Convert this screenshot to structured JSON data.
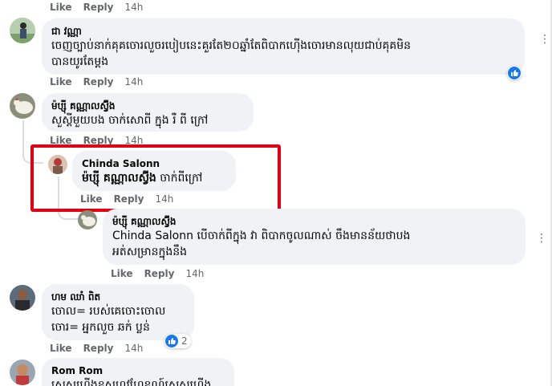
{
  "colors": {
    "accent": "#1877f2",
    "highlight": "#e40010",
    "bubble": "#f0f2f5",
    "meta": "#65676b"
  },
  "top_actions": {
    "like": "Like",
    "reply": "Reply",
    "time": "14h"
  },
  "comments": [
    {
      "author": "ជា វណ្ណា",
      "lines": [
        "ចេញច្បាប់នាក់គុគចោរលួចរបៀបនេះគួរតែ២០ឆ្នាំតែពិបាកហ៊ើងចោរមានលុយជាប់គុគមិន",
        "បានយូរតែម្តង"
      ],
      "like": "Like",
      "reply": "Reply",
      "time": "14h",
      "reaction_icon": "like-icon"
    },
    {
      "author": "ម៉ប្ស៊ី គណ្ណាលស៊្វីង",
      "lines": [
        "សួស្ដីមួយបង ចាក់សោពី ក្នុង រឺ ពី ក្រៅ"
      ],
      "like": "Like",
      "reply": "Reply",
      "time": "14h"
    },
    {
      "author": "Chinda Salonn",
      "mention": "ម៉ប្ស៊ី គណ្ណាលស៊្វីង",
      "text": " ចាក់ពីក្រៅ",
      "like": "Like",
      "reply": "Reply",
      "time": "14h"
    },
    {
      "author": "ម៉ប្ស៊ី គណ្ណាលស៊្វីង",
      "mention": "Chinda Salonn",
      "text": " បើចាក់ពីក្នុង វា ពិបាកចូលណាស់ ចឹងមានន័យថាបង",
      "line2": "អត់សម្រានក្នុងនឹង",
      "like": "Like",
      "reply": "Reply",
      "time": "14h"
    },
    {
      "author": "ហម ឈាំ ពិត",
      "lines": [
        "ចោល= របស់គេចោះចោល",
        "ចោរ= អ្នកលួច ឆក់ ប្លន់"
      ],
      "like": "Like",
      "reply": "Reply",
      "time": "14h",
      "reaction_icon": "like-icon",
      "reaction_count": "2"
    },
    {
      "author": "Rom Rom",
      "lines": [
        "សេសហើងខុសហ្មូវហែខណ៍សេសហើង"
      ]
    }
  ]
}
